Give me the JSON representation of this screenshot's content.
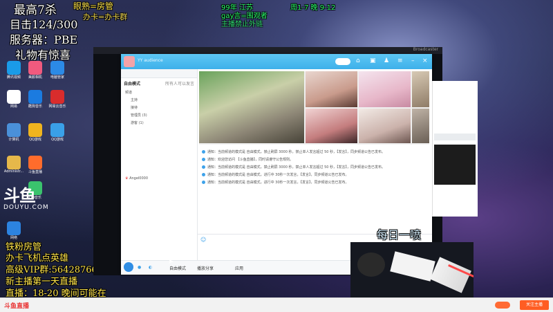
{
  "overlay": {
    "line1_a": "最高7杀",
    "line1_b": "眼熟=房管",
    "line1_c": "办卡=办卡群",
    "line2": "目击124/300",
    "line3": "服务器：PBE",
    "line4": "礼物有惊喜",
    "top_right_1": "99年 江苏",
    "top_right_2": "周1-7 晚 9-12",
    "top_right_3": "gay言=围观者",
    "top_right_4": "主播禁止外链",
    "bottom_1": "铁粉房管",
    "bottom_2": "办卡飞机点英雄",
    "bottom_3": "高级VIP群:564287663",
    "bottom_4": "新主播第一天直播",
    "bottom_5": "直播：18-20 晚间可能在",
    "daily": "每日一喷"
  },
  "desktop": {
    "logo_big": "斗鱼",
    "logo_small": "DOUYU.COM",
    "icons": [
      {
        "label": "腾讯视频",
        "color": "#1a9be8"
      },
      {
        "label": "美颜相机",
        "color": "#f05a7e"
      },
      {
        "label": "电脑管家",
        "color": "#2c8ae6"
      },
      {
        "label": "网易",
        "color": "#ffffff"
      },
      {
        "label": "酷狗音乐",
        "color": "#1b7be0"
      },
      {
        "label": "网易云音乐",
        "color": "#d92c2c"
      },
      {
        "label": "计算机",
        "color": "#4a90d9"
      },
      {
        "label": "QQ游戏",
        "color": "#f0b41e"
      },
      {
        "label": "QQ游戏",
        "color": "#3aa0e8"
      },
      {
        "label": "Administr...",
        "color": "#e6b84a"
      },
      {
        "label": "斗鱼直播",
        "color": "#ff6c2c"
      },
      {
        "label": "QQ音乐",
        "color": "#3ac36d"
      },
      {
        "label": "网络",
        "color": "#2c83e0"
      }
    ]
  },
  "dark_window": {
    "title": "Broadcaster"
  },
  "qq": {
    "title": "YY audience",
    "left": {
      "mode": "自由模式",
      "mode_hint": "所有人可以发言",
      "rows": [
        "频道",
        "主持",
        "接待",
        "管理员 (3)",
        "游客 (1)"
      ],
      "member_name": "Angel0000"
    },
    "messages": [
      "通知：当前频道的模式是 自由模式，禁止刷屏 3000 秒，禁止单人发言超过 50 秒，【发言】，同步频道公告已发布。",
      "通知：欢迎您访问 【斗鱼直播】，同时请遵守公告规则。",
      "通知：当前频道的模式是 自由模式，禁止刷屏 3000 秒，禁止单人发言超过 50 秒，【发言】，同步频道公告已发布。",
      "通知：当前频道的模式是 自由模式，进行中 30秒一次发言，【发言】，同步频道公告已发布。",
      "通知：当前频道的模式是 自由模式，进行中 30秒一次发言，【发言】，同步频道公告已发布。"
    ],
    "bottom": {
      "free_mode": "自由模式",
      "share": "播放分享",
      "app": "应用"
    }
  },
  "bottom_bar": {
    "brand": "斗鱼直播",
    "toggle_label": "",
    "follow": "关注主播"
  }
}
